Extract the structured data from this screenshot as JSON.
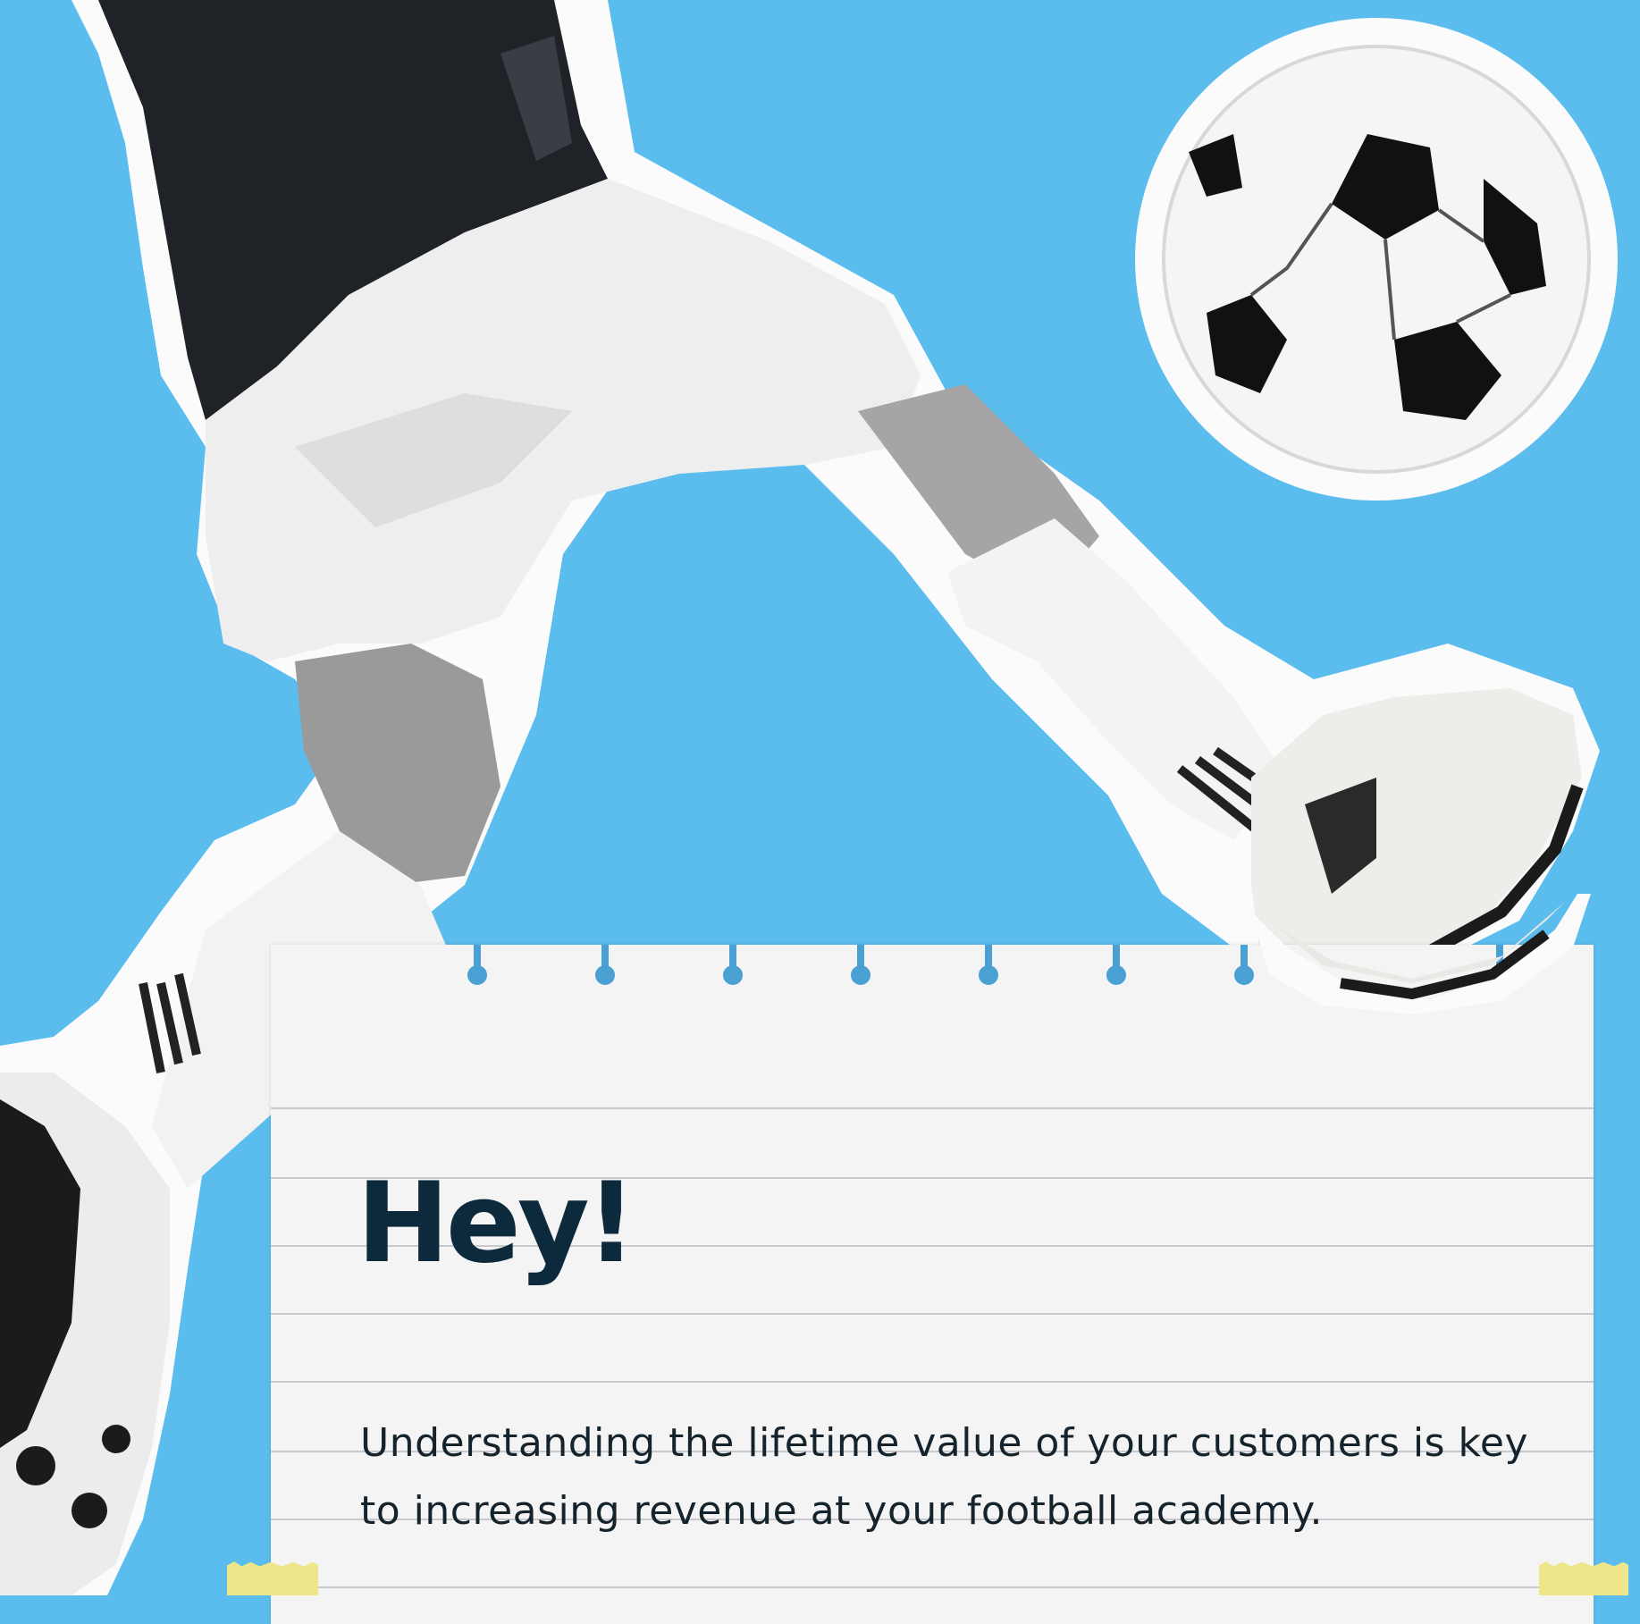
{
  "note": {
    "title": "Hey!",
    "body": "Understanding the lifetime value of your customers is key to increasing revenue at your football academy."
  },
  "colors": {
    "background": "#5bbcee",
    "paper": "#f4f4f4",
    "heading": "#0d2a3c",
    "hole": "#4a9fd3",
    "tape": "#efe68a"
  },
  "images": {
    "player": "football-player-kicking",
    "ball": "soccer-ball"
  }
}
